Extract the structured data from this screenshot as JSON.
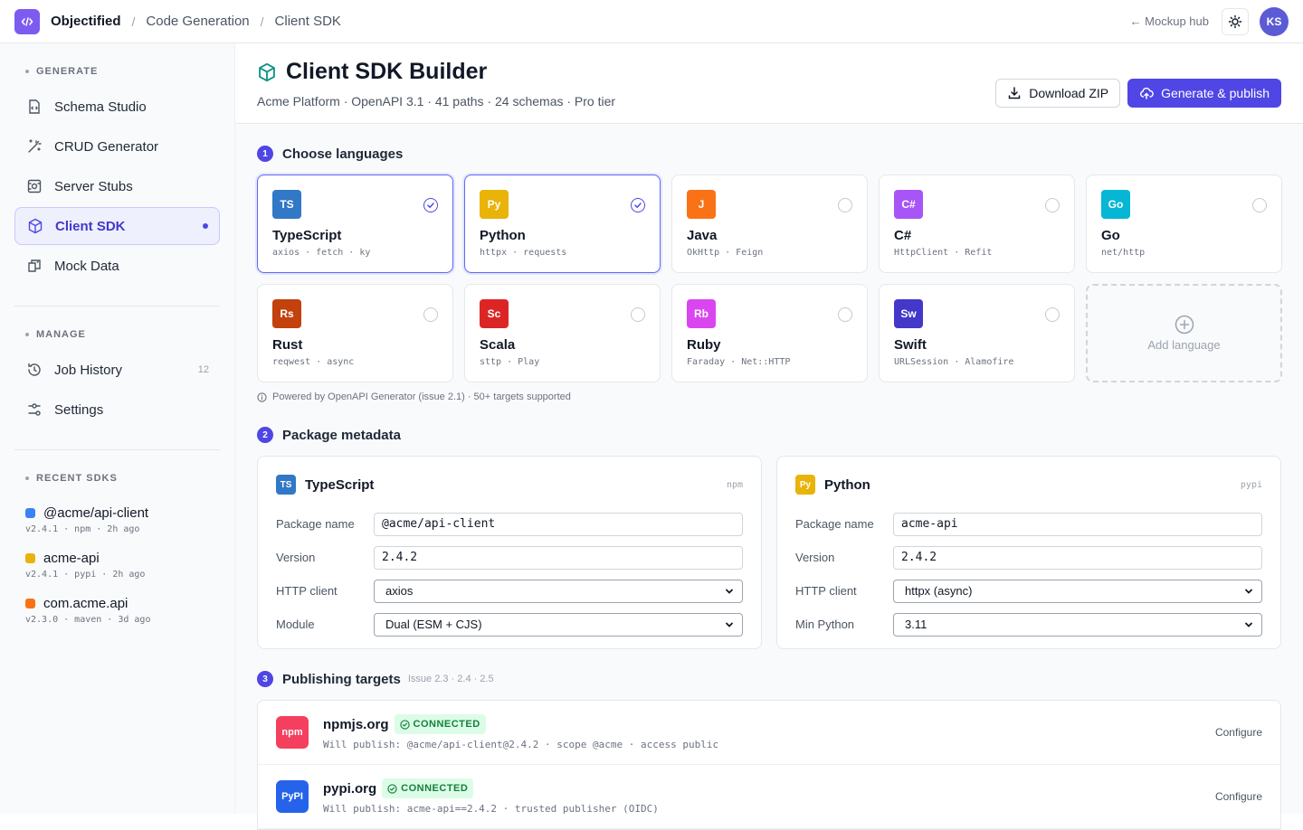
{
  "topbar": {
    "brand": "Objectified",
    "crumbs": [
      "Code Generation",
      "Client SDK"
    ],
    "hub_link": "← Mockup hub",
    "avatar": "KS"
  },
  "sidebar": {
    "generate_heading": "GENERATE",
    "generate_items": [
      {
        "label": "Schema Studio",
        "icon": "schema-icon"
      },
      {
        "label": "CRUD Generator",
        "icon": "wand-icon"
      },
      {
        "label": "Server Stubs",
        "icon": "server-icon"
      },
      {
        "label": "Client SDK",
        "icon": "package-icon",
        "active": true
      },
      {
        "label": "Mock Data",
        "icon": "mock-data-icon"
      }
    ],
    "manage_heading": "MANAGE",
    "manage_items": [
      {
        "label": "Job History",
        "count": "12",
        "icon": "history-icon"
      },
      {
        "label": "Settings",
        "icon": "settings-sliders-icon"
      }
    ],
    "recent_heading": "RECENT SDKS",
    "recent": [
      {
        "name": "@acme/api-client",
        "meta": "v2.4.1 · npm · 2h ago",
        "color": "#3b82f6"
      },
      {
        "name": "acme-api",
        "meta": "v2.4.1 · pypi · 2h ago",
        "color": "#eab308"
      },
      {
        "name": "com.acme.api",
        "meta": "v2.3.0 · maven · 3d ago",
        "color": "#f97316"
      }
    ]
  },
  "header": {
    "title": "Client SDK Builder",
    "subtitle": "Acme Platform · OpenAPI 3.1 · 41 paths · 24 schemas · Pro tier",
    "download_label": "Download ZIP",
    "publish_label": "Generate & publish"
  },
  "languages_section": {
    "step": "1",
    "title": "Choose languages",
    "cards": [
      {
        "code": "TS",
        "name": "TypeScript",
        "libs": "axios · fetch · ky",
        "color": "#3178c6",
        "selected": true
      },
      {
        "code": "Py",
        "name": "Python",
        "libs": "httpx · requests",
        "color": "#eab308",
        "selected": true
      },
      {
        "code": "J",
        "name": "Java",
        "libs": "OkHttp · Feign",
        "color": "#f97316",
        "selected": false
      },
      {
        "code": "C#",
        "name": "C#",
        "libs": "HttpClient · Refit",
        "color": "#a855f7",
        "selected": false
      },
      {
        "code": "Go",
        "name": "Go",
        "libs": "net/http",
        "color": "#06b6d4",
        "selected": false
      },
      {
        "code": "Rs",
        "name": "Rust",
        "libs": "reqwest · async",
        "color": "#c2410c",
        "selected": false
      },
      {
        "code": "Sc",
        "name": "Scala",
        "libs": "sttp · Play",
        "color": "#dc2626",
        "selected": false
      },
      {
        "code": "Rb",
        "name": "Ruby",
        "libs": "Faraday · Net::HTTP",
        "color": "#d946ef",
        "selected": false
      },
      {
        "code": "Sw",
        "name": "Swift",
        "libs": "URLSession · Alamofire",
        "color": "#4338ca",
        "selected": false
      }
    ],
    "add_label": "Add language",
    "powered": "Powered by OpenAPI Generator (issue 2.1) · 50+ targets supported"
  },
  "metadata_section": {
    "step": "2",
    "title": "Package metadata",
    "packages": [
      {
        "code": "TS",
        "color": "#3178c6",
        "title": "TypeScript",
        "registry": "npm",
        "fields": [
          {
            "label": "Package name",
            "value": "@acme/api-client",
            "kind": "input"
          },
          {
            "label": "Version",
            "value": "2.4.2",
            "kind": "input"
          },
          {
            "label": "HTTP client",
            "value": "axios",
            "kind": "select"
          },
          {
            "label": "Module",
            "value": "Dual (ESM + CJS)",
            "kind": "select"
          }
        ]
      },
      {
        "code": "Py",
        "color": "#eab308",
        "title": "Python",
        "registry": "pypi",
        "fields": [
          {
            "label": "Package name",
            "value": "acme-api",
            "kind": "input"
          },
          {
            "label": "Version",
            "value": "2.4.2",
            "kind": "input"
          },
          {
            "label": "HTTP client",
            "value": "httpx (async)",
            "kind": "select"
          },
          {
            "label": "Min Python",
            "value": "3.11",
            "kind": "select"
          }
        ]
      }
    ]
  },
  "publishing_section": {
    "step": "3",
    "title": "Publishing targets",
    "note": "Issue 2.3 · 2.4 · 2.5",
    "targets": [
      {
        "logo": "npm",
        "logo_color": "#f43f5e",
        "name": "npmjs.org",
        "status": "CONNECTED",
        "detail": "Will publish: @acme/api-client@2.4.2 · scope @acme · access public",
        "action": "Configure"
      },
      {
        "logo": "PyPI",
        "logo_color": "#2563eb",
        "name": "pypi.org",
        "status": "CONNECTED",
        "detail": "Will publish: acme-api==2.4.2 · trusted publisher (OIDC)",
        "action": "Configure"
      }
    ]
  }
}
